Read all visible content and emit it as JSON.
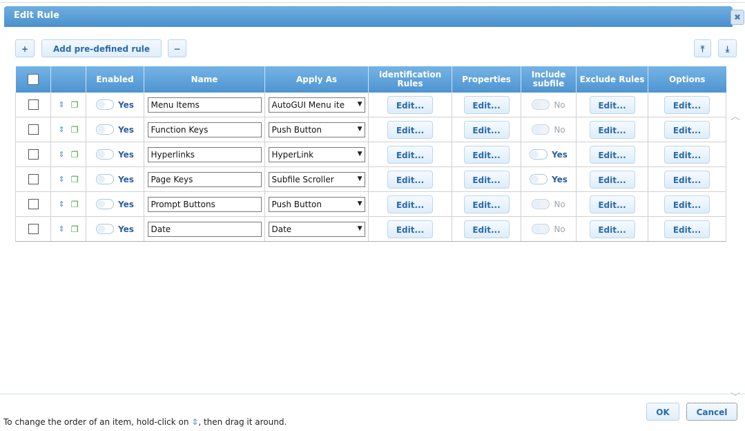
{
  "dialog": {
    "title": "Edit Rule",
    "close_glyph": "✖"
  },
  "toolbar": {
    "add_glyph": "+",
    "add_predefined_label": "Add pre-defined rule",
    "remove_glyph": "−",
    "move_top_glyph": "⤒",
    "move_bottom_glyph": "⤓"
  },
  "table": {
    "headers": {
      "enabled": "Enabled",
      "name": "Name",
      "apply_as": "Apply As",
      "identification_rules": "Identification Rules",
      "properties": "Properties",
      "include_subfile": "Include subfile",
      "exclude_rules": "Exclude Rules",
      "options": "Options"
    },
    "edit_label": "Edit...",
    "rows": [
      {
        "enabled": "Yes",
        "name": "Menu Items",
        "apply_as": "AutoGUI Menu ite",
        "include_subfile": "No"
      },
      {
        "enabled": "Yes",
        "name": "Function Keys",
        "apply_as": "Push Button",
        "include_subfile": "No"
      },
      {
        "enabled": "Yes",
        "name": "Hyperlinks",
        "apply_as": "HyperLink",
        "include_subfile": "Yes"
      },
      {
        "enabled": "Yes",
        "name": "Page Keys",
        "apply_as": "Subfile Scroller",
        "include_subfile": "Yes"
      },
      {
        "enabled": "Yes",
        "name": "Prompt Buttons",
        "apply_as": "Push Button",
        "include_subfile": "No"
      },
      {
        "enabled": "Yes",
        "name": "Date",
        "apply_as": "Date",
        "include_subfile": "No"
      }
    ]
  },
  "footer": {
    "hint_before": "To change the order of an item, hold-click on ",
    "hint_after": ", then drag it around.",
    "ok_label": "OK",
    "cancel_label": "Cancel"
  },
  "icons": {
    "reorder": "reorder-updown-icon",
    "copy": "copy-icon",
    "dropdown": "dropdown-arrow-icon"
  },
  "colors": {
    "titlebar": "#5a9fd8",
    "header": "#5b9ed8",
    "button_text": "#2a6aa8"
  }
}
